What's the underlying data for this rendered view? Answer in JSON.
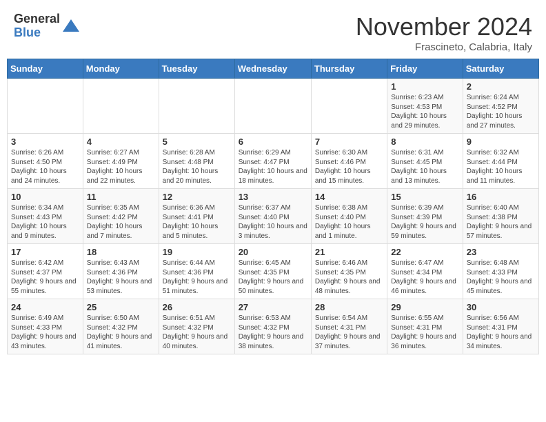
{
  "logo": {
    "general": "General",
    "blue": "Blue"
  },
  "title": "November 2024",
  "location": "Frascineto, Calabria, Italy",
  "weekdays": [
    "Sunday",
    "Monday",
    "Tuesday",
    "Wednesday",
    "Thursday",
    "Friday",
    "Saturday"
  ],
  "weeks": [
    [
      {
        "day": "",
        "info": ""
      },
      {
        "day": "",
        "info": ""
      },
      {
        "day": "",
        "info": ""
      },
      {
        "day": "",
        "info": ""
      },
      {
        "day": "",
        "info": ""
      },
      {
        "day": "1",
        "info": "Sunrise: 6:23 AM\nSunset: 4:53 PM\nDaylight: 10 hours and 29 minutes."
      },
      {
        "day": "2",
        "info": "Sunrise: 6:24 AM\nSunset: 4:52 PM\nDaylight: 10 hours and 27 minutes."
      }
    ],
    [
      {
        "day": "3",
        "info": "Sunrise: 6:26 AM\nSunset: 4:50 PM\nDaylight: 10 hours and 24 minutes."
      },
      {
        "day": "4",
        "info": "Sunrise: 6:27 AM\nSunset: 4:49 PM\nDaylight: 10 hours and 22 minutes."
      },
      {
        "day": "5",
        "info": "Sunrise: 6:28 AM\nSunset: 4:48 PM\nDaylight: 10 hours and 20 minutes."
      },
      {
        "day": "6",
        "info": "Sunrise: 6:29 AM\nSunset: 4:47 PM\nDaylight: 10 hours and 18 minutes."
      },
      {
        "day": "7",
        "info": "Sunrise: 6:30 AM\nSunset: 4:46 PM\nDaylight: 10 hours and 15 minutes."
      },
      {
        "day": "8",
        "info": "Sunrise: 6:31 AM\nSunset: 4:45 PM\nDaylight: 10 hours and 13 minutes."
      },
      {
        "day": "9",
        "info": "Sunrise: 6:32 AM\nSunset: 4:44 PM\nDaylight: 10 hours and 11 minutes."
      }
    ],
    [
      {
        "day": "10",
        "info": "Sunrise: 6:34 AM\nSunset: 4:43 PM\nDaylight: 10 hours and 9 minutes."
      },
      {
        "day": "11",
        "info": "Sunrise: 6:35 AM\nSunset: 4:42 PM\nDaylight: 10 hours and 7 minutes."
      },
      {
        "day": "12",
        "info": "Sunrise: 6:36 AM\nSunset: 4:41 PM\nDaylight: 10 hours and 5 minutes."
      },
      {
        "day": "13",
        "info": "Sunrise: 6:37 AM\nSunset: 4:40 PM\nDaylight: 10 hours and 3 minutes."
      },
      {
        "day": "14",
        "info": "Sunrise: 6:38 AM\nSunset: 4:40 PM\nDaylight: 10 hours and 1 minute."
      },
      {
        "day": "15",
        "info": "Sunrise: 6:39 AM\nSunset: 4:39 PM\nDaylight: 9 hours and 59 minutes."
      },
      {
        "day": "16",
        "info": "Sunrise: 6:40 AM\nSunset: 4:38 PM\nDaylight: 9 hours and 57 minutes."
      }
    ],
    [
      {
        "day": "17",
        "info": "Sunrise: 6:42 AM\nSunset: 4:37 PM\nDaylight: 9 hours and 55 minutes."
      },
      {
        "day": "18",
        "info": "Sunrise: 6:43 AM\nSunset: 4:36 PM\nDaylight: 9 hours and 53 minutes."
      },
      {
        "day": "19",
        "info": "Sunrise: 6:44 AM\nSunset: 4:36 PM\nDaylight: 9 hours and 51 minutes."
      },
      {
        "day": "20",
        "info": "Sunrise: 6:45 AM\nSunset: 4:35 PM\nDaylight: 9 hours and 50 minutes."
      },
      {
        "day": "21",
        "info": "Sunrise: 6:46 AM\nSunset: 4:35 PM\nDaylight: 9 hours and 48 minutes."
      },
      {
        "day": "22",
        "info": "Sunrise: 6:47 AM\nSunset: 4:34 PM\nDaylight: 9 hours and 46 minutes."
      },
      {
        "day": "23",
        "info": "Sunrise: 6:48 AM\nSunset: 4:33 PM\nDaylight: 9 hours and 45 minutes."
      }
    ],
    [
      {
        "day": "24",
        "info": "Sunrise: 6:49 AM\nSunset: 4:33 PM\nDaylight: 9 hours and 43 minutes."
      },
      {
        "day": "25",
        "info": "Sunrise: 6:50 AM\nSunset: 4:32 PM\nDaylight: 9 hours and 41 minutes."
      },
      {
        "day": "26",
        "info": "Sunrise: 6:51 AM\nSunset: 4:32 PM\nDaylight: 9 hours and 40 minutes."
      },
      {
        "day": "27",
        "info": "Sunrise: 6:53 AM\nSunset: 4:32 PM\nDaylight: 9 hours and 38 minutes."
      },
      {
        "day": "28",
        "info": "Sunrise: 6:54 AM\nSunset: 4:31 PM\nDaylight: 9 hours and 37 minutes."
      },
      {
        "day": "29",
        "info": "Sunrise: 6:55 AM\nSunset: 4:31 PM\nDaylight: 9 hours and 36 minutes."
      },
      {
        "day": "30",
        "info": "Sunrise: 6:56 AM\nSunset: 4:31 PM\nDaylight: 9 hours and 34 minutes."
      }
    ]
  ]
}
